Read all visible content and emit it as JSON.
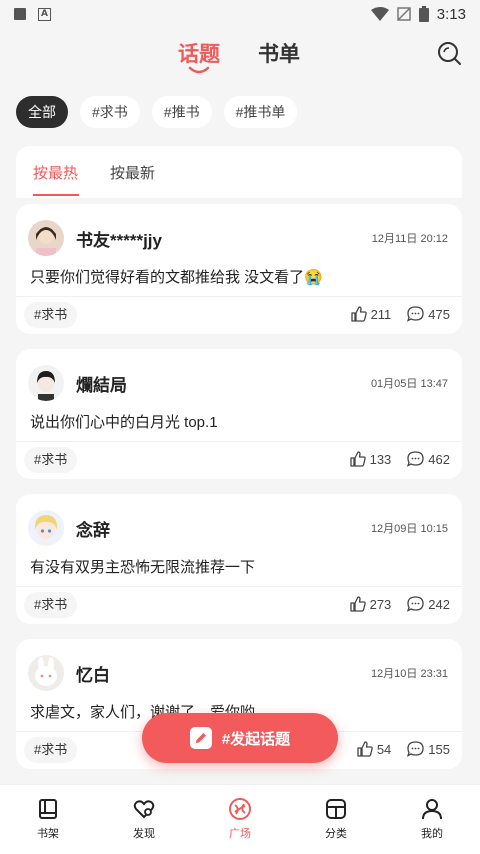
{
  "status_bar": {
    "time": "3:13"
  },
  "top_nav": {
    "tabs": [
      {
        "label": "话题",
        "active": true
      },
      {
        "label": "书单",
        "active": false
      }
    ]
  },
  "filters": [
    {
      "label": "全部",
      "active": true
    },
    {
      "label": "#求书"
    },
    {
      "label": "#推书"
    },
    {
      "label": "#推书单"
    }
  ],
  "sort_tabs": [
    {
      "label": "按最热",
      "active": true
    },
    {
      "label": "按最新"
    }
  ],
  "posts": [
    {
      "author": "书友*****jjy",
      "time": "12月11日 20:12",
      "text": "只要你们觉得好看的文都推给我 没文看了😭",
      "tag": "#求书",
      "likes": "211",
      "comments": "475"
    },
    {
      "author": "爛結局",
      "time": "01月05日 13:47",
      "text": "说出你们心中的白月光 top.1",
      "tag": "#求书",
      "likes": "133",
      "comments": "462"
    },
    {
      "author": "念辞",
      "time": "12月09日 10:15",
      "text": "有没有双男主恐怖无限流推荐一下",
      "tag": "#求书",
      "likes": "273",
      "comments": "242"
    },
    {
      "author": "忆白",
      "time": "12月10日 23:31",
      "text": "求虐文，家人们，谢谢了，爱你哟",
      "tag": "#求书",
      "likes": "54",
      "comments": "155"
    }
  ],
  "fab": {
    "label": "#发起话题"
  },
  "bottom_nav": [
    {
      "label": "书架",
      "icon": "book-icon"
    },
    {
      "label": "发现",
      "icon": "discover-icon"
    },
    {
      "label": "广场",
      "icon": "plaza-icon",
      "active": true
    },
    {
      "label": "分类",
      "icon": "category-icon"
    },
    {
      "label": "我的",
      "icon": "profile-icon"
    }
  ],
  "colors": {
    "accent": "#f05a5a",
    "fab": "#f25a5c",
    "chip_active": "#2e2e2e",
    "background": "#f5f5f5"
  }
}
